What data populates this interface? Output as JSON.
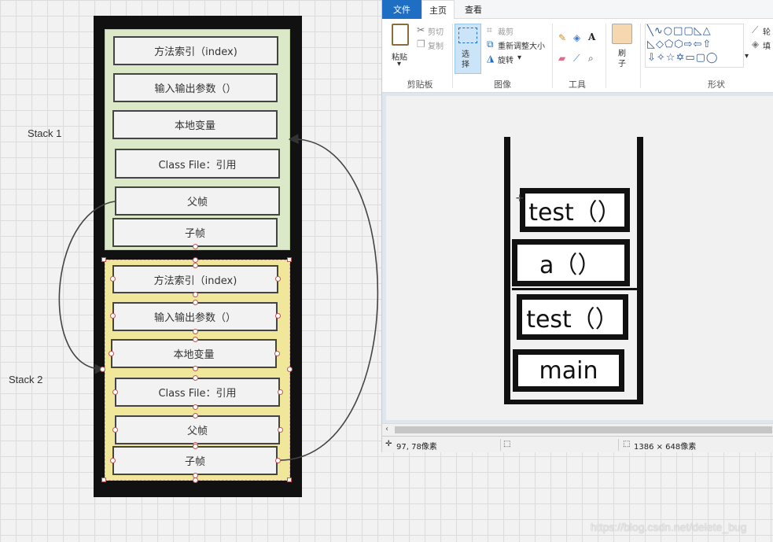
{
  "diagram": {
    "stack1_label": "Stack 1",
    "stack2_label": "Stack 2",
    "stack1_frames": [
      "方法索引（index)",
      "输入输出参数（）",
      "本地变量",
      "Class File：引用",
      "父帧",
      "子帧"
    ],
    "stack2_frames": [
      "方法索引（index)",
      "输入输出参数（）",
      "本地变量",
      "Class File：引用",
      "父帧",
      "子帧"
    ],
    "colors": {
      "stack1_bg": "#dbe9c8",
      "stack2_bg": "#f1e79a",
      "frame_border": "#111111"
    }
  },
  "paint": {
    "tabs": {
      "file": "文件",
      "home": "主页",
      "view": "查看"
    },
    "clipboard": {
      "paste": "粘贴",
      "cut": "剪切",
      "copy": "复制",
      "group": "剪贴板"
    },
    "image": {
      "select": "选择",
      "crop": "裁剪",
      "resize": "重新调整大小",
      "rotate": "旋转",
      "group": "图像"
    },
    "tools": {
      "group": "工具"
    },
    "brush": {
      "label": "刷子"
    },
    "shapes": {
      "group": "形状",
      "outline": "轮",
      "fill": "填"
    },
    "canvas_stack": [
      "test（）",
      "a（）",
      "test（）",
      "main"
    ],
    "status": {
      "cursor": "97, 78像素",
      "size": "1386 × 648像素"
    }
  },
  "watermark": "https://blog.csdn.net/delete_bug"
}
